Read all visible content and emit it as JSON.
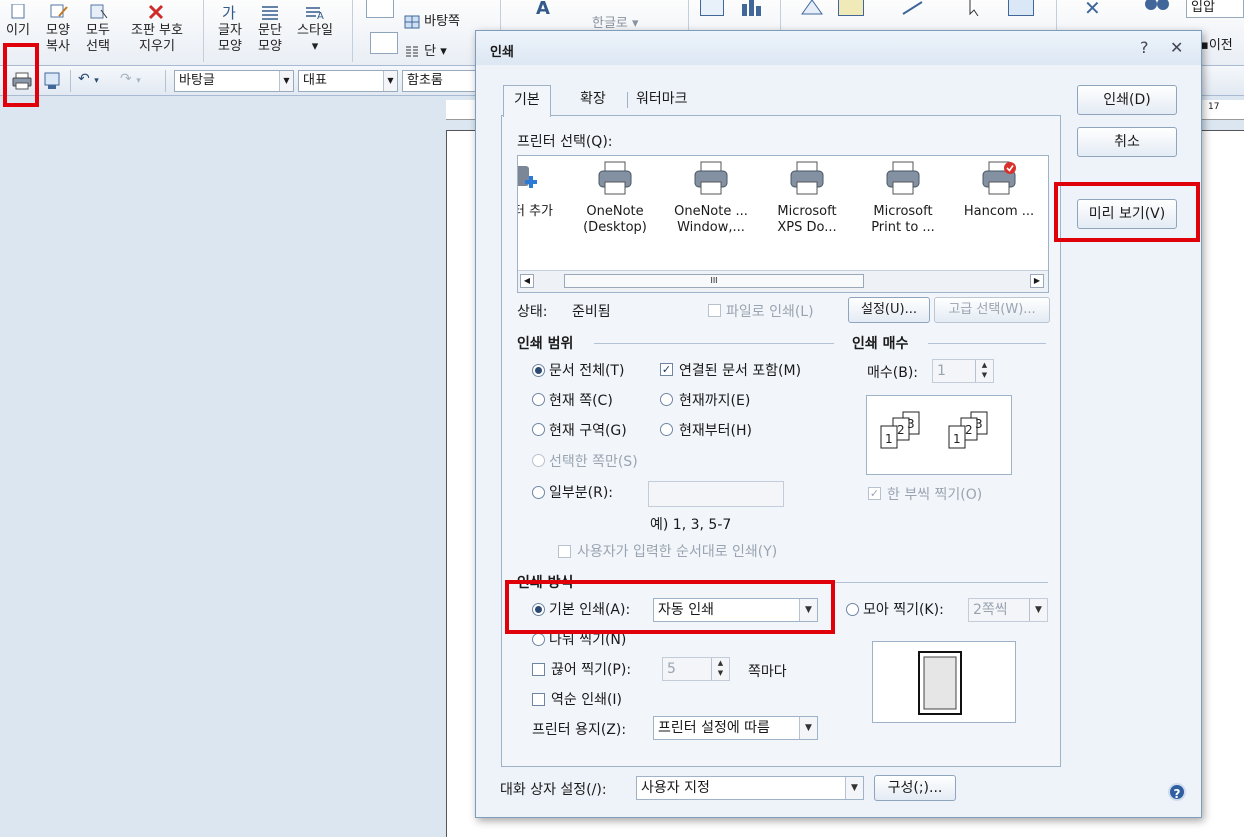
{
  "ribbon": {
    "items": [
      {
        "label": "이기",
        "label2": ""
      },
      {
        "label": "모양",
        "label2": "복사"
      },
      {
        "label": "모두",
        "label2": "선택"
      },
      {
        "label": "조판 부호",
        "label2": "지우기"
      },
      {
        "label": "글자",
        "label2": "모양"
      },
      {
        "label": "문단",
        "label2": "모양"
      },
      {
        "label": "스타일",
        "label2": "▾"
      }
    ],
    "background_label": "바탕쪽",
    "column_label": "단 ▾",
    "hangul_label": "한글로 ▾",
    "right_field": "입압",
    "prev_label": "이전"
  },
  "toolbar": {
    "style_combo": "바탕글",
    "para_combo": "대표",
    "font_combo": "함초롬"
  },
  "ruler": {
    "mark": "17"
  },
  "dialog": {
    "title": "인쇄",
    "help": "?",
    "close": "✕",
    "tabs": [
      {
        "label": "기본"
      },
      {
        "label": "확장"
      },
      {
        "label": "워터마크"
      }
    ],
    "printer_select_label": "프린터 선택(Q):",
    "printers": [
      {
        "line1": "터 추가",
        "line2": ""
      },
      {
        "line1": "OneNote",
        "line2": "(Desktop)"
      },
      {
        "line1": "OneNote ...",
        "line2": "Window,..."
      },
      {
        "line1": "Microsoft",
        "line2": "XPS Do..."
      },
      {
        "line1": "Microsoft",
        "line2": "Print to ..."
      },
      {
        "line1": "Hancom ...",
        "line2": ""
      }
    ],
    "scroll_mid": "III",
    "status_label": "상태:",
    "status_value": "준비됨",
    "print_to_file": "파일로 인쇄(L)",
    "settings_button": "설정(U)...",
    "advanced_button": "고급 선택(W)...",
    "range": {
      "title": "인쇄 범위",
      "whole": "문서 전체(T)",
      "linked": "연결된 문서 포함(M)",
      "current_page": "현재 쪽(C)",
      "until_current": "현재까지(E)",
      "current_section": "현재 구역(G)",
      "from_current": "현재부터(H)",
      "selected_pages": "선택한 쪽만(S)",
      "partial": "일부분(R):",
      "example": "예) 1, 3, 5-7",
      "user_order": "사용자가 입력한 순서대로 인쇄(Y)"
    },
    "copies": {
      "title": "인쇄 매수",
      "label": "매수(B):",
      "value": "1",
      "collate": "한 부씩 찍기(O)"
    },
    "method": {
      "title": "인쇄 방식",
      "basic": "기본 인쇄(A):",
      "basic_value": "자동 인쇄",
      "multi": "나눠 찍기(N)",
      "collect": "모아 찍기(K):",
      "collect_value": "2쪽씩",
      "cut": "끊어 찍기(P):",
      "cut_value": "5",
      "per_page": "쪽마다",
      "reverse": "역순 인쇄(I)",
      "paper_label": "프린터 용지(Z):",
      "paper_value": "프린터 설정에 따름"
    },
    "buttons": {
      "print": "인쇄(D)",
      "cancel": "취소",
      "preview": "미리 보기(V)",
      "config": "구성(;)..."
    },
    "dialog_setting_label": "대화 상자 설정(/):",
    "dialog_setting_value": "사용자 지정"
  }
}
